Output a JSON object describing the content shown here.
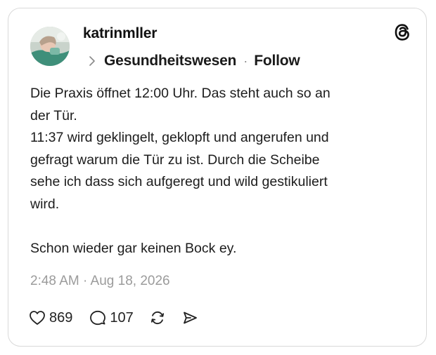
{
  "post": {
    "username": "katrinmller",
    "topic": "Gesundheitswesen",
    "separator": "·",
    "follow_label": "Follow",
    "body_lines": [
      "Die Praxis öffnet 12:00 Uhr. Das steht auch so an",
      "der Tür.",
      "11:37 wird geklingelt, geklopft und angerufen und",
      "gefragt warum die Tür zu ist. Durch die Scheibe",
      "sehe ich dass sich aufgeregt und wild gestikuliert",
      "wird.",
      "",
      "Schon wieder gar keinen Bock ey."
    ],
    "timestamp": "2:48 AM · Aug 18, 2026",
    "likes": "869",
    "replies": "107"
  },
  "icons": {
    "logo": "threads-logo-icon",
    "topic": "chevron-right-icon",
    "like": "heart-icon",
    "reply": "speech-bubble-icon",
    "repost": "repost-icon",
    "share": "send-icon"
  },
  "colors": {
    "text": "#1c1c1c",
    "muted": "#9b9b9b",
    "border": "#d9d9d9"
  }
}
